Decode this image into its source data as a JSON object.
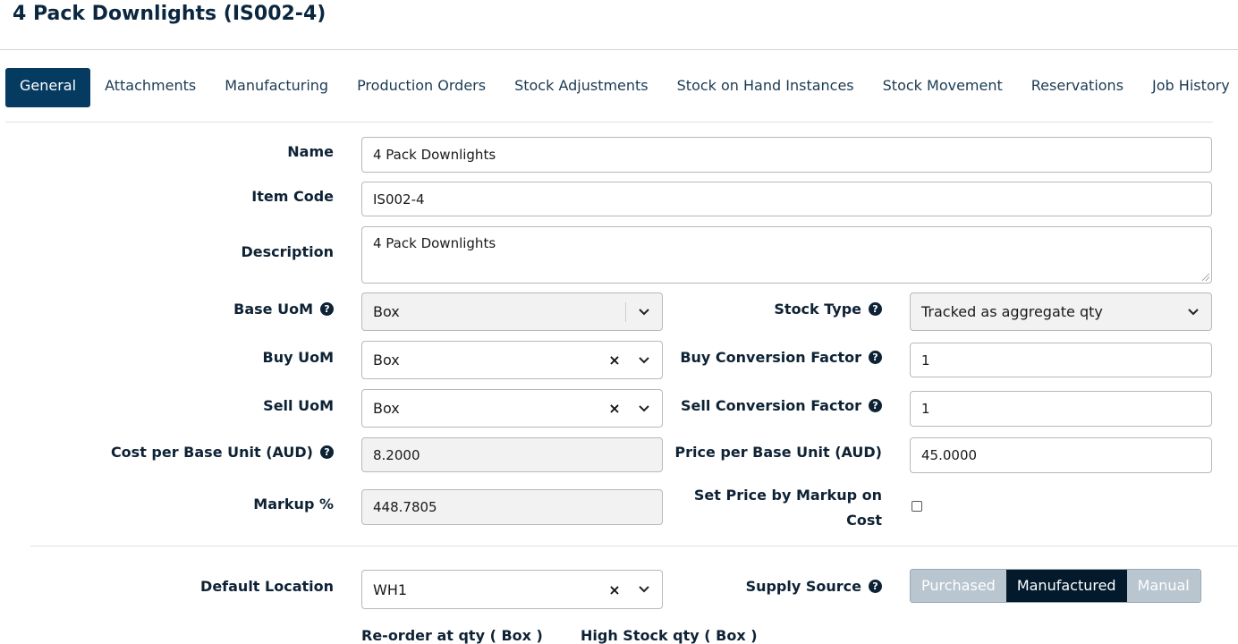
{
  "page_title": "4 Pack Downlights (IS002-4)",
  "tabs": [
    "General",
    "Attachments",
    "Manufacturing",
    "Production Orders",
    "Stock Adjustments",
    "Stock on Hand Instances",
    "Stock Movement",
    "Reservations",
    "Job History"
  ],
  "active_tab": "General",
  "form": {
    "name": {
      "label": "Name",
      "value": "4 Pack Downlights"
    },
    "item_code": {
      "label": "Item Code",
      "value": "IS002-4"
    },
    "description": {
      "label": "Description",
      "value": "4 Pack Downlights"
    },
    "base_uom": {
      "label": "Base UoM",
      "value": "Box"
    },
    "stock_type": {
      "label": "Stock Type",
      "value": "Tracked as aggregate qty"
    },
    "buy_uom": {
      "label": "Buy UoM",
      "value": "Box"
    },
    "buy_conversion_factor": {
      "label": "Buy Conversion Factor",
      "value": "1"
    },
    "sell_uom": {
      "label": "Sell UoM",
      "value": "Box"
    },
    "sell_conversion_factor": {
      "label": "Sell Conversion Factor",
      "value": "1"
    },
    "cost_per_base_unit": {
      "label": "Cost per Base Unit (AUD)",
      "value": "8.2000"
    },
    "price_per_base_unit": {
      "label": "Price per Base Unit (AUD)",
      "value": "45.0000"
    },
    "markup": {
      "label": "Markup %",
      "value": "448.7805"
    },
    "set_price_by_markup": {
      "label_line1": "Set Price by Markup on",
      "label_line2": "Cost",
      "checked": false
    },
    "default_location": {
      "label": "Default Location",
      "value": "WH1"
    },
    "supply_source": {
      "label": "Supply Source",
      "options": [
        "Purchased",
        "Manufactured",
        "Manual"
      ],
      "selected": "Manufactured"
    },
    "reorder_qty_label": "Re-order at qty ( Box )",
    "high_stock_qty_label": "High Stock qty ( Box )"
  },
  "icons": {
    "help": "question-circle-icon",
    "clear": "clear-x-icon",
    "dropdown": "chevron-down-icon"
  },
  "help_glyph": "?",
  "clear_glyph": "×",
  "colors": {
    "accent": "#063b61",
    "segment_active": "#021a2c",
    "segment_inactive": "#b9c6d0"
  }
}
